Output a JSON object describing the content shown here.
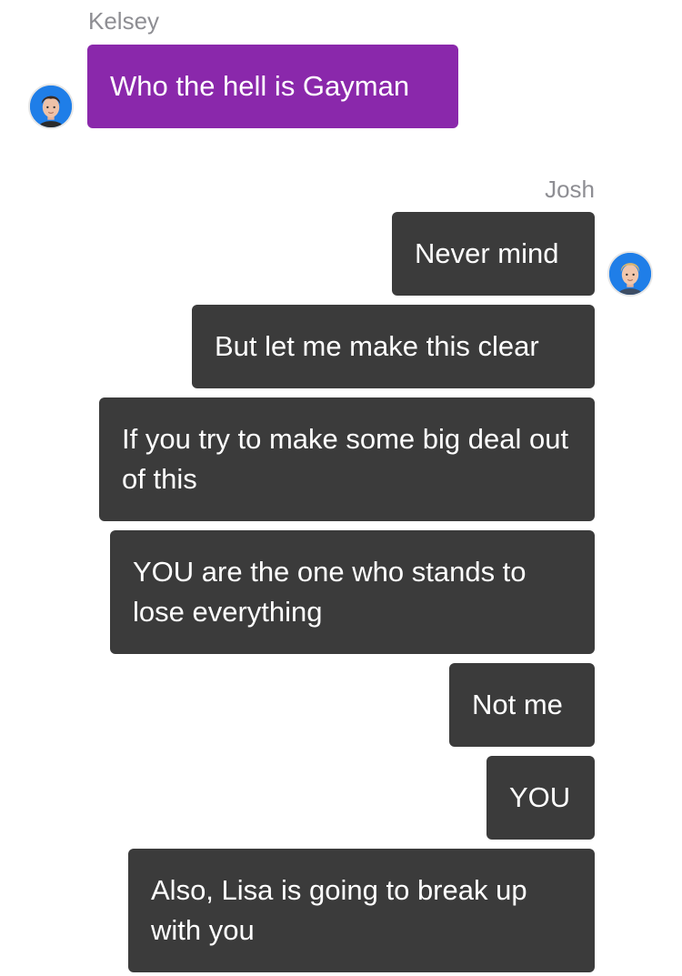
{
  "conversation": {
    "incoming": {
      "sender_name": "Kelsey",
      "messages": [
        "Who the hell is Gayman"
      ]
    },
    "outgoing": {
      "sender_name": "Josh",
      "messages": [
        "Never mind",
        "But let me make this clear",
        "If you try to make some big deal out of this",
        "YOU are the one who stands to lose everything",
        "Not me",
        "YOU",
        "Also, Lisa is going to break up with you"
      ]
    }
  },
  "colors": {
    "incoming_bubble": "#8a28ab",
    "outgoing_bubble": "#3b3b3b",
    "sender_name_text": "#8e8e93",
    "avatar_background": "#1f7ee8"
  },
  "icons": {
    "kelsey_avatar": "avatar-dark-hair-boy",
    "josh_avatar": "avatar-blond-hair-boy"
  }
}
